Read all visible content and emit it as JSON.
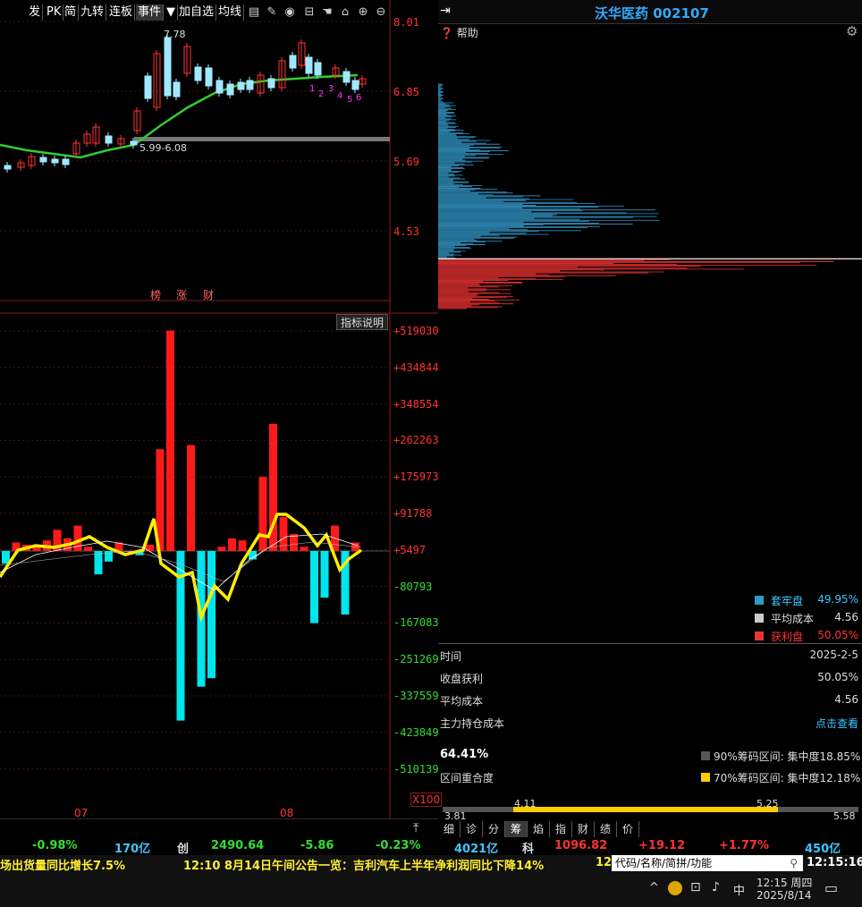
{
  "toolbar": {
    "buttons": [
      "发",
      "PK",
      "简",
      "九转",
      "连板",
      "事件",
      "加自选",
      "均线"
    ],
    "dropdown_glyph": "▼"
  },
  "stock": {
    "name_code": "沃华医药 002107"
  },
  "right_panel": {
    "help_label": "帮助",
    "legend": [
      {
        "label": "套牢盘",
        "value": "49.95%",
        "color": "#3399cc"
      },
      {
        "label": "平均成本",
        "value": "4.56",
        "color": "#cccccc"
      },
      {
        "label": "获利盘",
        "value": "50.05%",
        "color": "#ee3333"
      }
    ],
    "rows": [
      {
        "label": "时间",
        "value": "2025-2-5"
      },
      {
        "label": "收盘获利",
        "value": "50.05%"
      },
      {
        "label": "平均成本",
        "value": "4.56"
      },
      {
        "label": "主力持仓成本",
        "value": "点击查看"
      }
    ],
    "concentration_pct": "64.41%",
    "overlap_label": "区间重合度",
    "ranges": [
      {
        "label": "90%筹码区间: 集中度18.85%",
        "color": "#555555"
      },
      {
        "label": "70%筹码区间: 集中度12.18%",
        "color": "#ffcc00"
      }
    ],
    "range_bar": {
      "low": "3.81",
      "high": "5.58",
      "inner_low": "4.11",
      "inner_high": "5.25"
    },
    "tabs": [
      "细",
      "诊",
      "分",
      "筹",
      "焰",
      "指",
      "财",
      "绩",
      "价"
    ],
    "active_tab": "筹"
  },
  "kline_panel": {
    "y_ticks": [
      "8.01",
      "6.85",
      "5.69",
      "4.53"
    ],
    "high_label": "7.78",
    "range_label": "5.99-6.08",
    "markers": [
      "榜",
      "涨",
      "财"
    ],
    "counts": [
      "1",
      "2",
      "3",
      "4",
      "5",
      "6"
    ]
  },
  "macd_panel": {
    "title_button": "指标说明",
    "y_ticks": [
      "+519030",
      "+434844",
      "+348554",
      "+262263",
      "+175973",
      "+91788",
      "+5497",
      "-80793",
      "-167083",
      "-251269",
      "-337559",
      "-423849",
      "-510139"
    ],
    "zoom_label": "X100",
    "x_labels": [
      "07",
      "08"
    ]
  },
  "status_bar": {
    "items": [
      {
        "text": "-0.98%",
        "color": "#33dd33"
      },
      {
        "text": "170亿",
        "color": "#3fc7ff"
      },
      {
        "text": "创",
        "color": "#dddddd"
      },
      {
        "text": "2490.64",
        "color": "#33dd33"
      },
      {
        "text": "-5.86",
        "color": "#33dd33"
      },
      {
        "text": "-0.23%",
        "color": "#33dd33"
      },
      {
        "text": "4021亿",
        "color": "#3fc7ff"
      },
      {
        "text": "科",
        "color": "#dddddd"
      },
      {
        "text": "1096.82",
        "color": "#ff3333"
      },
      {
        "text": "+19.12",
        "color": "#ff3333"
      },
      {
        "text": "+1.77%",
        "color": "#ff3333"
      },
      {
        "text": "450亿",
        "color": "#3fc7ff"
      }
    ]
  },
  "ticker": {
    "segments": [
      "场出货量同比增长7.5%",
      "12:10 8月14日午间公告一览：吉利汽车上半年净利润同比下降14%",
      "12"
    ],
    "search_placeholder": "代码/名称/简拼/功能",
    "clock": "12:15:16"
  },
  "taskbar": {
    "time": "12:15 周四",
    "date": "2025/8/14",
    "ime": "中"
  },
  "chart_data": {
    "type": "bar",
    "title": "",
    "ylim": [
      -510139,
      519030
    ],
    "values": [
      -30000,
      20000,
      15000,
      10000,
      25000,
      50000,
      30000,
      60000,
      10000,
      -55000,
      -25000,
      20000,
      0,
      -10000,
      15000,
      240000,
      520000,
      -400000,
      250000,
      -320000,
      -300000,
      10000,
      30000,
      25000,
      -20000,
      175000,
      300000,
      80000,
      40000,
      10000,
      -170000,
      -110000,
      60000,
      -150000,
      20000
    ]
  }
}
